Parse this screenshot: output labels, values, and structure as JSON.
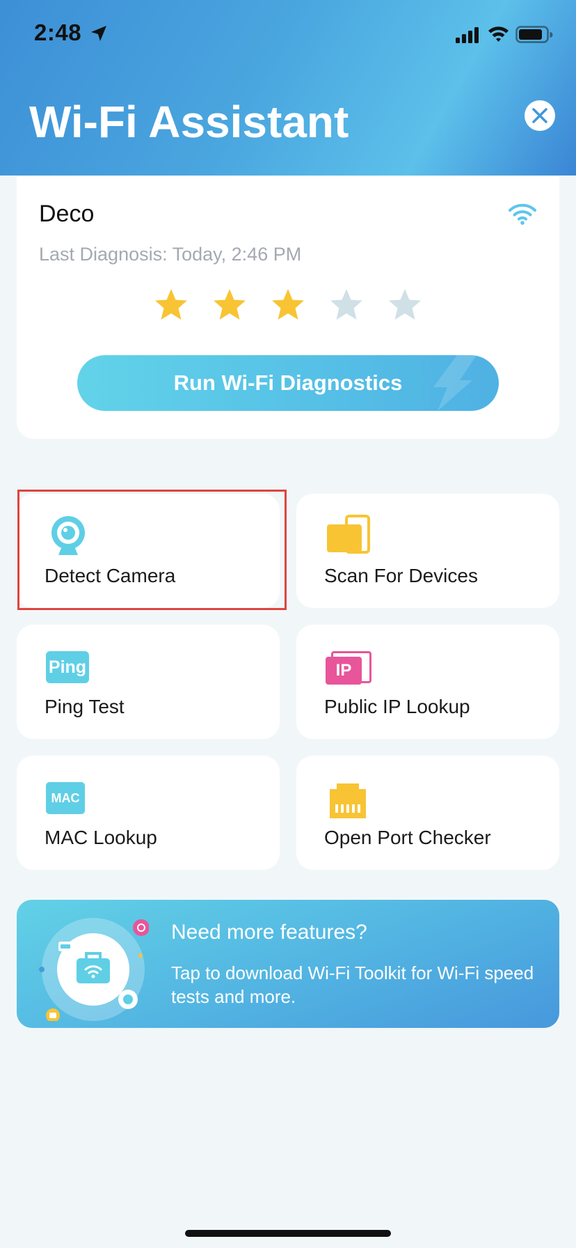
{
  "status_bar": {
    "time": "2:48",
    "icons": [
      "location-arrow-icon",
      "cellular-signal-icon",
      "wifi-icon",
      "battery-icon"
    ]
  },
  "header": {
    "title": "Wi-Fi Assistant",
    "close_icon": "close-icon"
  },
  "network_card": {
    "name": "Deco",
    "last_diagnosis": "Last Diagnosis: Today, 2:46 PM",
    "rating": {
      "value": 3,
      "max": 5
    },
    "run_button_label": "Run Wi-Fi Diagnostics"
  },
  "tools": [
    {
      "label": "Detect Camera",
      "icon": "camera-icon",
      "highlighted": true
    },
    {
      "label": "Scan For Devices",
      "icon": "devices-icon",
      "highlighted": false
    },
    {
      "label": "Ping Test",
      "icon": "ping-icon",
      "icon_text": "Ping",
      "highlighted": false
    },
    {
      "label": "Public IP Lookup",
      "icon": "ip-icon",
      "icon_text": "IP",
      "highlighted": false
    },
    {
      "label": "MAC Lookup",
      "icon": "mac-icon",
      "icon_text": "MAC",
      "highlighted": false
    },
    {
      "label": "Open Port Checker",
      "icon": "ethernet-port-icon",
      "highlighted": false
    }
  ],
  "promo_banner": {
    "title": "Need more features?",
    "description": "Tap to download Wi-Fi Toolkit for Wi-Fi speed tests and more."
  },
  "colors": {
    "star_filled": "#f8c434",
    "star_empty": "#cfe0e6",
    "accent_cyan": "#5fcfe6",
    "highlight_border": "#e0433f",
    "ip_pink": "#e8559a",
    "yellow": "#f8c434"
  }
}
